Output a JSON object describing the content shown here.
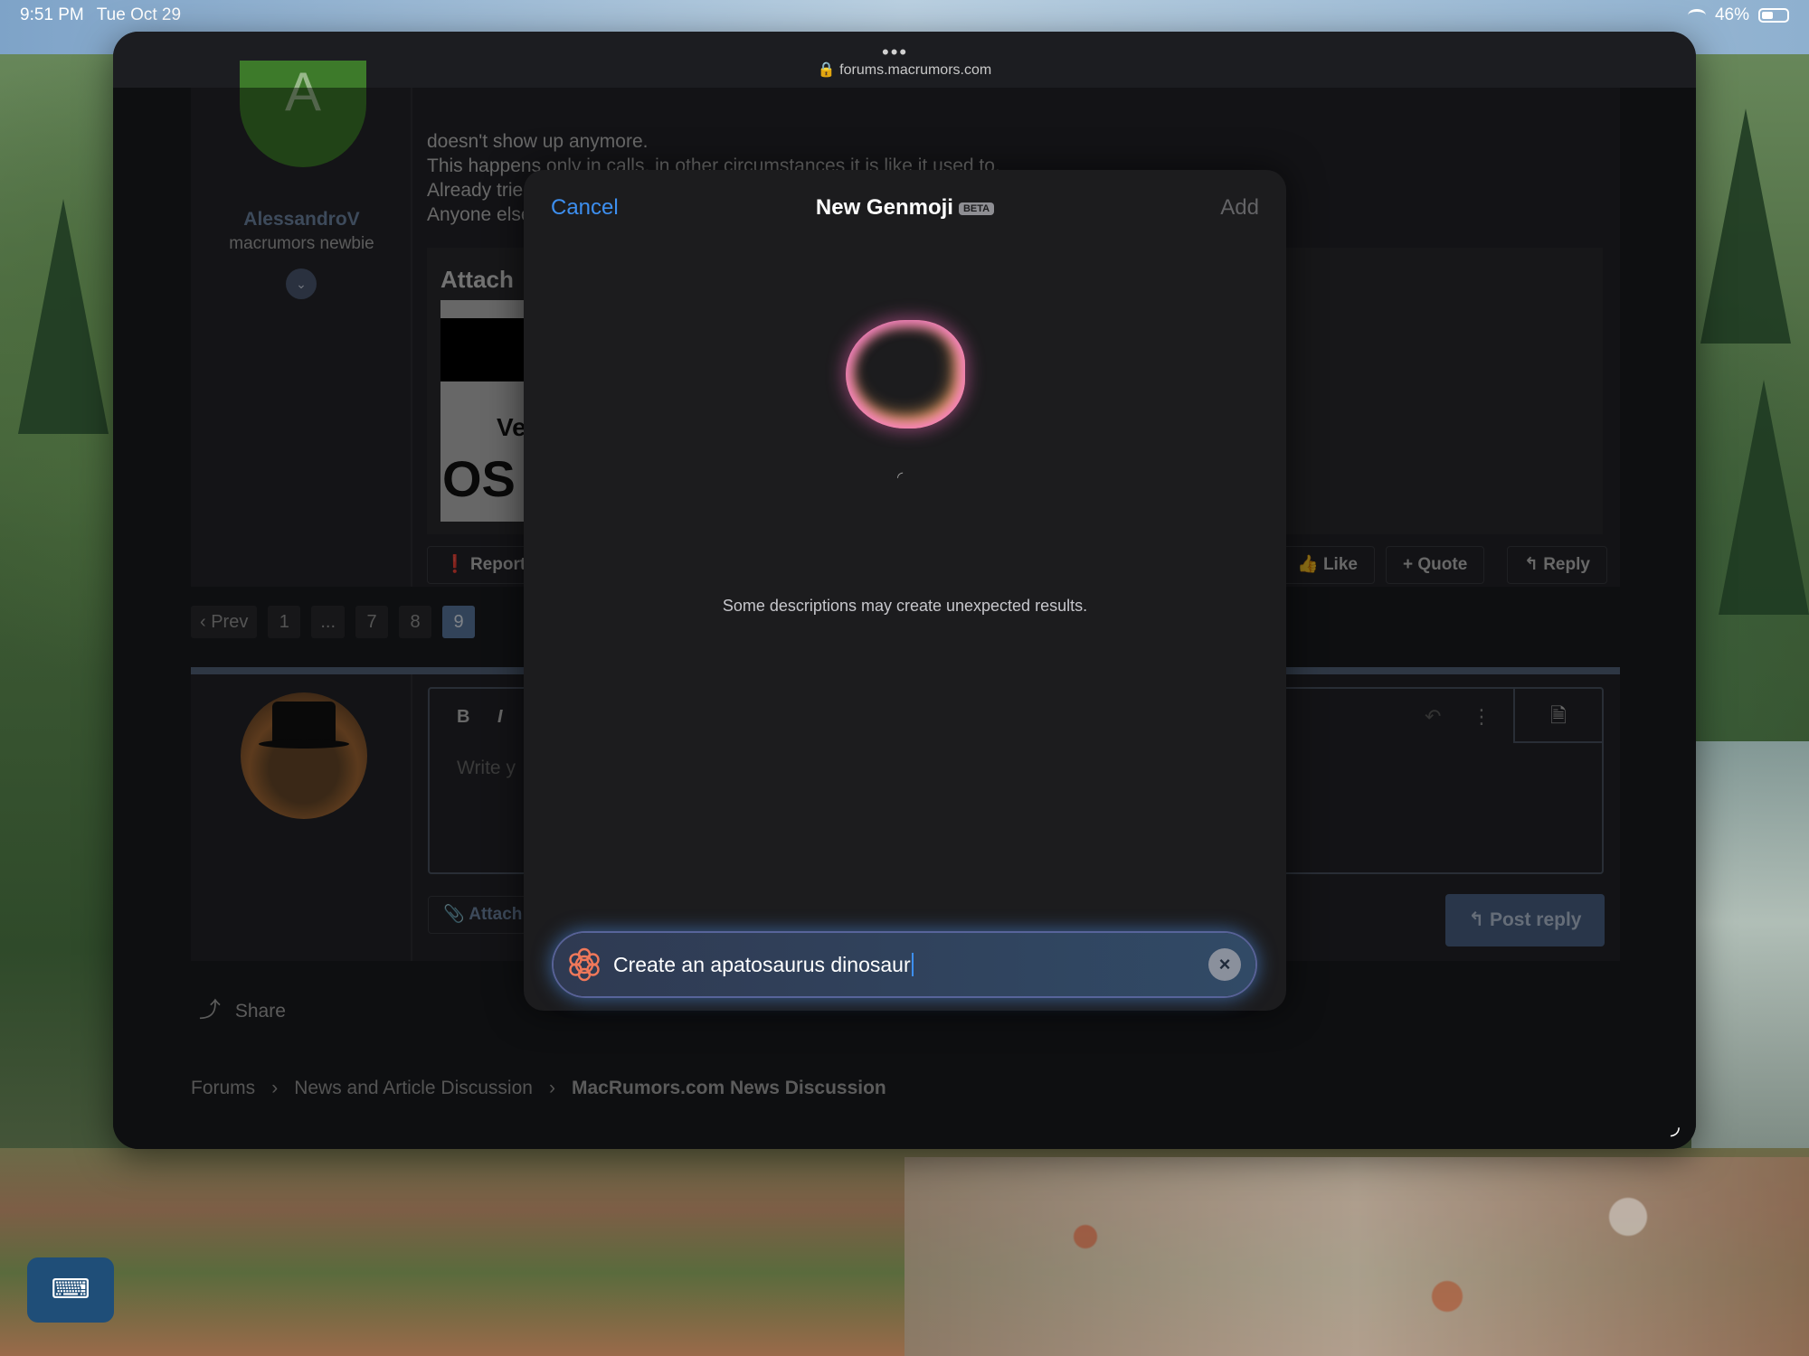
{
  "status_bar": {
    "time": "9:51 PM",
    "date": "Tue Oct 29",
    "battery": "46%",
    "wifi_icon": "wifi-icon",
    "battery_icon": "battery-icon"
  },
  "browser": {
    "url": "forums.macrumors.com",
    "dots": "•••"
  },
  "post": {
    "author_initial": "A",
    "author": "AlessandroV",
    "rank": "macrumors newbie",
    "lines": [
      "doesn't show up anymore.",
      "This happens only in calls, in other circumstances it is like it used to.",
      "Already tried hard resetting the iPhone.",
      "Anyone else?"
    ],
    "attach_title": "Attach",
    "attach_thumb_text1": "Ve",
    "attach_thumb_text2": "OS",
    "report": "Report",
    "like": "Like",
    "quote": "Quote",
    "reply": "Reply"
  },
  "pagination": {
    "prev": "Prev",
    "pages": [
      "1",
      "...",
      "7",
      "8",
      "9"
    ],
    "active": "9"
  },
  "reply_editor": {
    "bold": "B",
    "italic": "I",
    "placeholder": "Write y",
    "attach": "Attach",
    "post_reply": "Post reply"
  },
  "share": "Share",
  "breadcrumb": [
    "Forums",
    "News and Article Discussion",
    "MacRumors.com News Discussion"
  ],
  "modal": {
    "cancel": "Cancel",
    "title": "New Genmoji",
    "badge": "BETA",
    "add": "Add",
    "note": "Some descriptions may create unexpected results.",
    "prompt": "Create an apatosaurus dinosaur",
    "accent": "#3d8ff0"
  },
  "keyboard_button_icon": "keyboard-icon"
}
